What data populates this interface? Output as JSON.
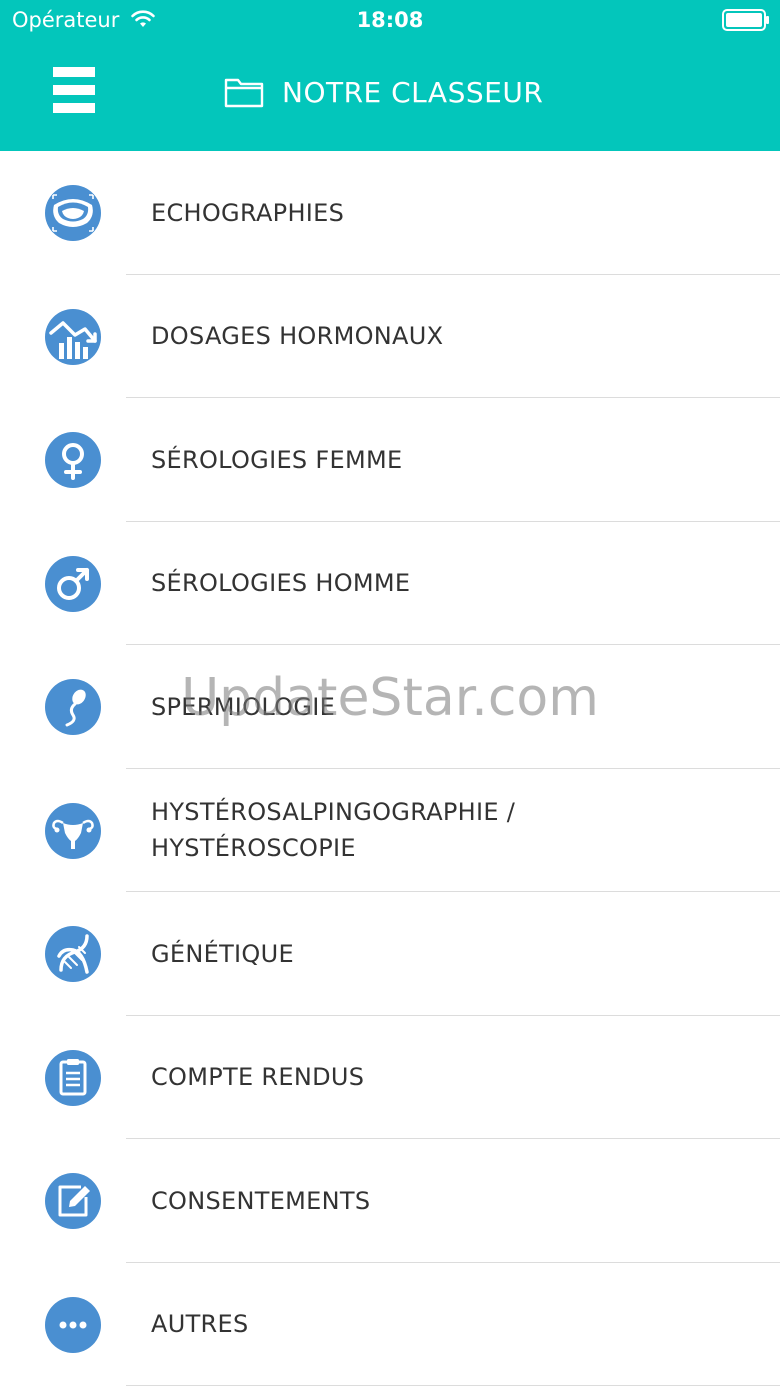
{
  "status_bar": {
    "carrier": "Opérateur",
    "time": "18:08",
    "wifi_icon": "wifi-icon",
    "battery_icon": "battery-icon"
  },
  "header": {
    "menu_icon": "hamburger-menu-icon",
    "folder_icon": "folder-icon",
    "title": "NOTRE CLASSEUR"
  },
  "colors": {
    "header_bg": "#03c6bb",
    "icon_bg": "#4a8fd1",
    "text": "#333333",
    "divider": "#dcdcdc"
  },
  "items": [
    {
      "label": "ECHOGRAPHIES",
      "icon": "ultrasound-icon"
    },
    {
      "label": "DOSAGES HORMONAUX",
      "icon": "chart-down-icon"
    },
    {
      "label": "SÉROLOGIES FEMME",
      "icon": "female-symbol-icon"
    },
    {
      "label": "SÉROLOGIES HOMME",
      "icon": "male-symbol-icon"
    },
    {
      "label": "SPERMIOLOGIE",
      "icon": "sperm-icon"
    },
    {
      "label": "HYSTÉROSALPINGOGRAPHIE /\nHYSTÉROSCOPIE",
      "icon": "uterus-icon"
    },
    {
      "label": "GÉNÉTIQUE",
      "icon": "dna-icon"
    },
    {
      "label": "COMPTE RENDUS",
      "icon": "clipboard-icon"
    },
    {
      "label": "CONSENTEMENTS",
      "icon": "edit-icon"
    },
    {
      "label": "AUTRES",
      "icon": "more-dots-icon"
    }
  ],
  "watermark": "UpdateStar.com"
}
